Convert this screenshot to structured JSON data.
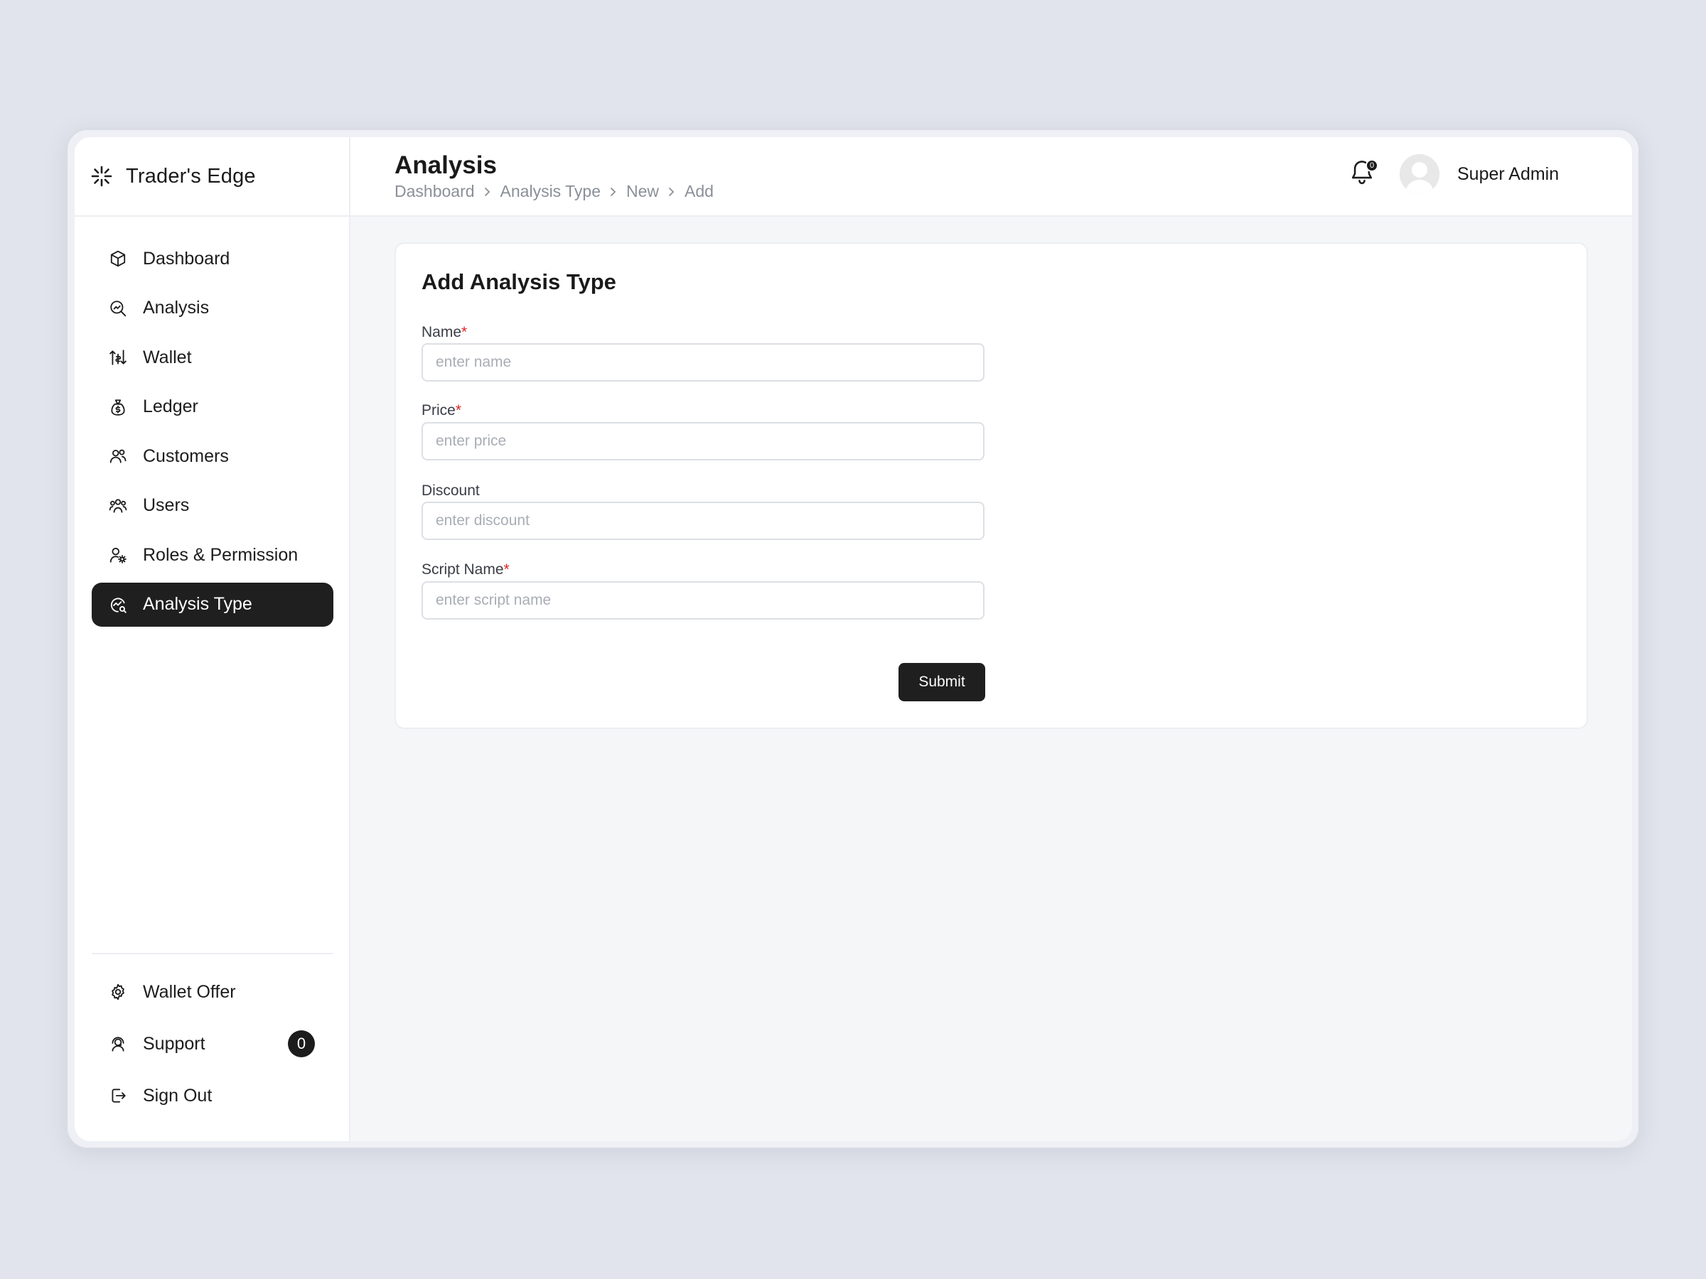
{
  "brand": {
    "name": "Trader's Edge",
    "logo_icon": "sparkle-logo-icon"
  },
  "sidebar": {
    "items": [
      {
        "label": "Dashboard",
        "icon": "cube-icon",
        "active": false
      },
      {
        "label": "Analysis",
        "icon": "magnifier-chart-icon",
        "active": false
      },
      {
        "label": "Wallet",
        "icon": "wallet-transfer-icon",
        "active": false
      },
      {
        "label": "Ledger",
        "icon": "money-bag-icon",
        "active": false
      },
      {
        "label": "Customers",
        "icon": "customers-icon",
        "active": false
      },
      {
        "label": "Users",
        "icon": "users-icon",
        "active": false
      },
      {
        "label": "Roles & Permission",
        "icon": "user-gear-icon",
        "active": false
      },
      {
        "label": "Analysis Type",
        "icon": "chart-search-icon",
        "active": true
      }
    ],
    "bottom_items": [
      {
        "label": "Wallet Offer",
        "icon": "gear-icon"
      },
      {
        "label": "Support",
        "icon": "support-agent-icon",
        "badge": "0"
      },
      {
        "label": "Sign Out",
        "icon": "sign-out-icon"
      }
    ],
    "active_color": "#1f1f1f"
  },
  "header": {
    "title": "Analysis",
    "breadcrumb": [
      "Dashboard",
      "Analysis Type",
      "New",
      "Add"
    ],
    "notification_count": "0",
    "user_name": "Super Admin"
  },
  "form": {
    "title": "Add Analysis Type",
    "fields": [
      {
        "label": "Name",
        "required": "*",
        "placeholder": "enter name",
        "value": ""
      },
      {
        "label": "Price",
        "required": "*",
        "placeholder": "enter price",
        "value": ""
      },
      {
        "label": "Discount",
        "required": "",
        "placeholder": "enter discount",
        "value": ""
      },
      {
        "label": "Script Name",
        "required": "*",
        "placeholder": "enter script name",
        "value": ""
      }
    ],
    "submit_label": "Submit"
  },
  "colors": {
    "background": "#e1e4ec",
    "primary_dark": "#1f1f1f",
    "required": "#e02424"
  }
}
